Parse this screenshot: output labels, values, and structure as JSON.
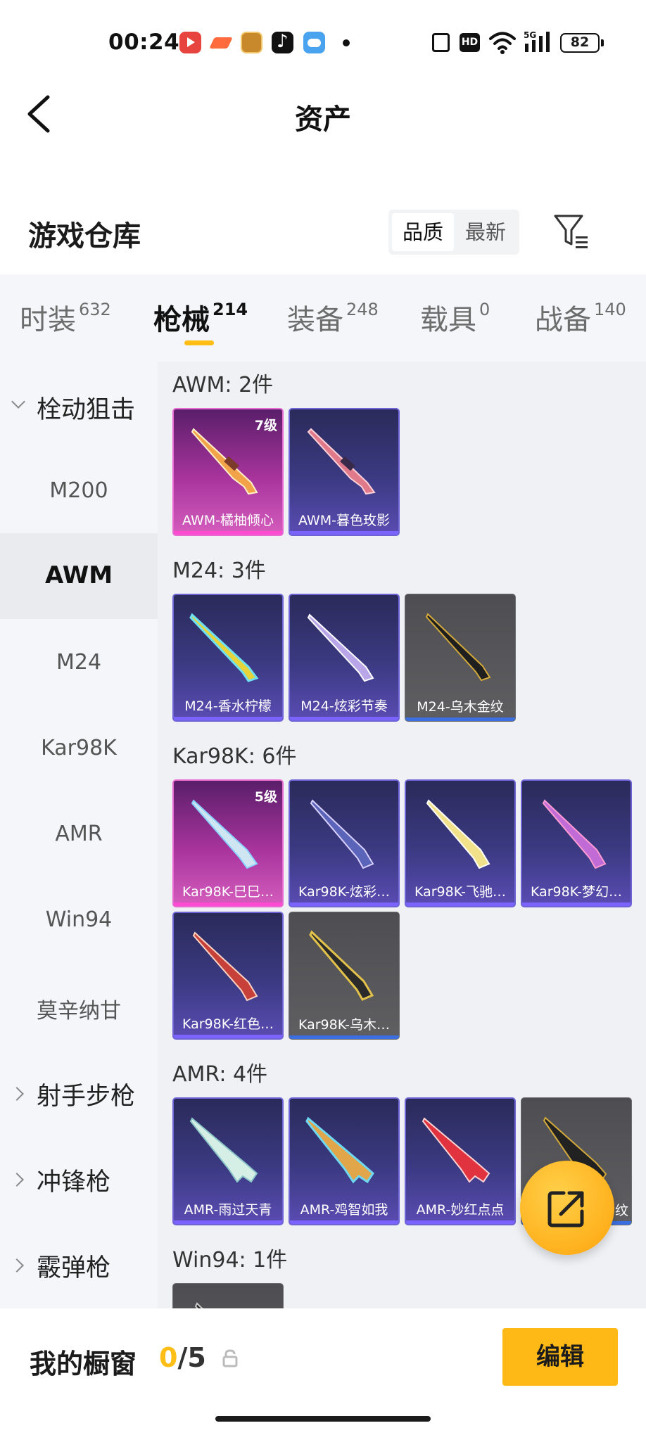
{
  "status_bar": {
    "time": "00:24",
    "battery": "82",
    "network_label": "HD",
    "icons": [
      "video-app-icon",
      "game-app-icon",
      "peace-elite-app-icon",
      "tiktok-app-icon",
      "weather-app-icon",
      "nfc-icon",
      "hd-icon",
      "wifi-icon",
      "5g-signal-icon",
      "battery-icon"
    ]
  },
  "nav": {
    "title": "资产",
    "back_icon": "back-arrow-icon"
  },
  "warehouse": {
    "title": "游戏仓库",
    "sort_options": [
      "品质",
      "最新"
    ],
    "sort_selected": "品质",
    "filter_icon": "filter-icon"
  },
  "tabs": [
    {
      "label": "时装",
      "count": "632"
    },
    {
      "label": "枪械",
      "count": "214",
      "active": true
    },
    {
      "label": "装备",
      "count": "248"
    },
    {
      "label": "载具",
      "count": "0"
    },
    {
      "label": "战备",
      "count": "140"
    }
  ],
  "sidebar": {
    "items": [
      {
        "label": "栓动狙击",
        "type": "group",
        "expanded": true
      },
      {
        "label": "M200"
      },
      {
        "label": "AWM",
        "active": true
      },
      {
        "label": "M24"
      },
      {
        "label": "Kar98K"
      },
      {
        "label": "AMR"
      },
      {
        "label": "Win94"
      },
      {
        "label": "莫辛纳甘"
      },
      {
        "label": "射手步枪",
        "type": "group"
      },
      {
        "label": "冲锋枪",
        "type": "group"
      },
      {
        "label": "霰弹枪",
        "type": "group"
      }
    ]
  },
  "sections": [
    {
      "title": "AWM: 2件",
      "items": [
        {
          "name": "AWM-橘柚倾心",
          "level": "7级",
          "rarity": "pink"
        },
        {
          "name": "AWM-暮色玫影",
          "rarity": "purple"
        }
      ]
    },
    {
      "title": "M24: 3件",
      "items": [
        {
          "name": "M24-香水柠檬",
          "rarity": "purple"
        },
        {
          "name": "M24-炫彩节奏",
          "rarity": "purple"
        },
        {
          "name": "M24-乌木金纹",
          "rarity": "grey"
        }
      ]
    },
    {
      "title": "Kar98K: 6件",
      "items": [
        {
          "name": "Kar98K-巳巳…",
          "level": "5级",
          "rarity": "pink"
        },
        {
          "name": "Kar98K-炫彩…",
          "rarity": "purple"
        },
        {
          "name": "Kar98K-飞驰…",
          "rarity": "purple"
        },
        {
          "name": "Kar98K-梦幻…",
          "rarity": "purple"
        },
        {
          "name": "Kar98K-红色…",
          "rarity": "purple"
        },
        {
          "name": "Kar98K-乌木…",
          "rarity": "grey"
        }
      ]
    },
    {
      "title": "AMR: 4件",
      "items": [
        {
          "name": "AMR-雨过天青",
          "rarity": "purple"
        },
        {
          "name": "AMR-鸡智如我",
          "rarity": "purple"
        },
        {
          "name": "AMR-妙红点点",
          "rarity": "purple"
        },
        {
          "name": "纹",
          "rarity": "grey"
        }
      ]
    },
    {
      "title": "Win94: 1件",
      "items": []
    }
  ],
  "fab": {
    "icon": "share-icon"
  },
  "showcase": {
    "label": "我的橱窗",
    "current": "0",
    "total": "/5",
    "lock_icon": "lock-icon",
    "edit_label": "编辑"
  },
  "colors": {
    "accent": "#ffbe16",
    "pink_rarity": "#e66ad0",
    "purple_rarity": "#6e64d6",
    "grey_rarity": "#5f5f62"
  }
}
